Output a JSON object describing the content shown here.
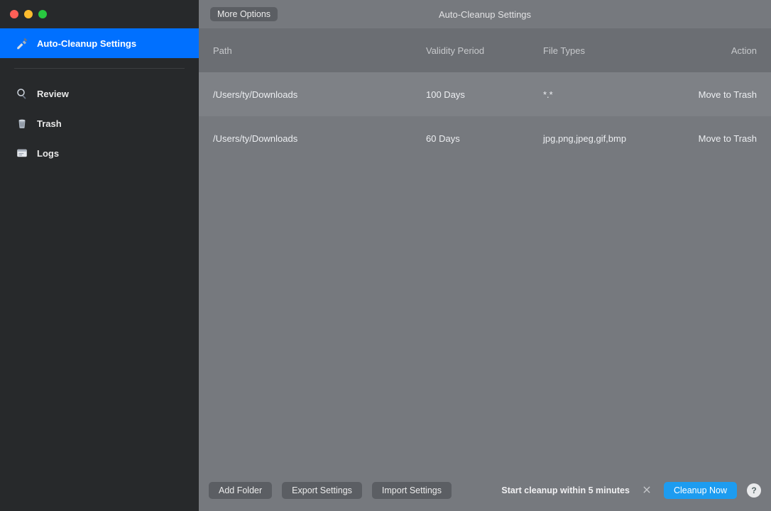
{
  "sidebar": {
    "items": [
      {
        "label": "Auto-Cleanup Settings"
      },
      {
        "label": "Review"
      },
      {
        "label": "Trash"
      },
      {
        "label": "Logs"
      }
    ]
  },
  "topbar": {
    "more_options": "More Options",
    "title": "Auto-Cleanup Settings"
  },
  "table": {
    "headers": {
      "path": "Path",
      "validity": "Validity Period",
      "filetypes": "File Types",
      "action": "Action"
    },
    "rows": [
      {
        "path": "/Users/ty/Downloads",
        "validity": "100 Days",
        "filetypes": "*.*",
        "action": "Move to Trash"
      },
      {
        "path": "/Users/ty/Downloads",
        "validity": "60 Days",
        "filetypes": "jpg,png,jpeg,gif,bmp",
        "action": "Move to Trash"
      }
    ]
  },
  "bottombar": {
    "add_folder": "Add Folder",
    "export_settings": "Export Settings",
    "import_settings": "Import Settings",
    "status": "Start cleanup within 5 minutes",
    "cleanup_now": "Cleanup Now",
    "help": "?"
  }
}
